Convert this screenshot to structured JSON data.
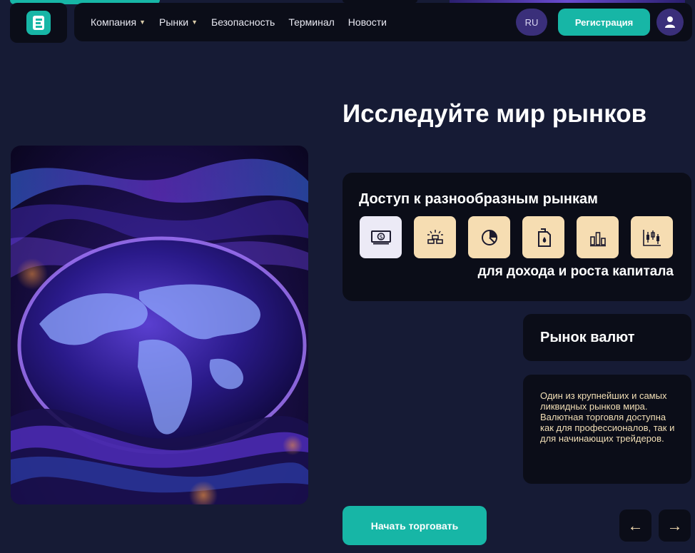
{
  "brand": {
    "logo_icon": "brand-logo-icon",
    "accent": "#17b6a6"
  },
  "nav": {
    "items": [
      {
        "label": "Компания",
        "has_dropdown": true
      },
      {
        "label": "Рынки",
        "has_dropdown": true
      },
      {
        "label": "Безопасность",
        "has_dropdown": false
      },
      {
        "label": "Терминал",
        "has_dropdown": false
      },
      {
        "label": "Новости",
        "has_dropdown": false
      }
    ],
    "language": "RU",
    "register_label": "Регистрация",
    "user_icon": "user-icon"
  },
  "hero": {
    "headline": "Исследуйте мир рынков",
    "image_icon": "globe-image"
  },
  "markets": {
    "title": "Доступ к разнообразным рынкам",
    "subtitle": "для дохода и роста капитала",
    "icons": [
      {
        "name": "currency-icon",
        "active": true
      },
      {
        "name": "commodities-icon",
        "active": false
      },
      {
        "name": "pie-chart-icon",
        "active": false
      },
      {
        "name": "oil-canister-icon",
        "active": false
      },
      {
        "name": "stocks-bars-icon",
        "active": false
      },
      {
        "name": "candlestick-icon",
        "active": false
      }
    ]
  },
  "selected_market": {
    "title": "Рынок валют",
    "description": "Один из крупнейших и самых ликвидных рынков мира. Валютная торговля доступна как для профессионалов, так и для начинающих трейдеров."
  },
  "actions": {
    "start_label": "Начать торговать",
    "prev_arrow": "←",
    "next_arrow": "→"
  },
  "colors": {
    "background": "#161b35",
    "card": "#0b0d18",
    "accent": "#17b6a6",
    "icon_tile": "#f6ddb2",
    "purple": "#3a2f7a"
  }
}
